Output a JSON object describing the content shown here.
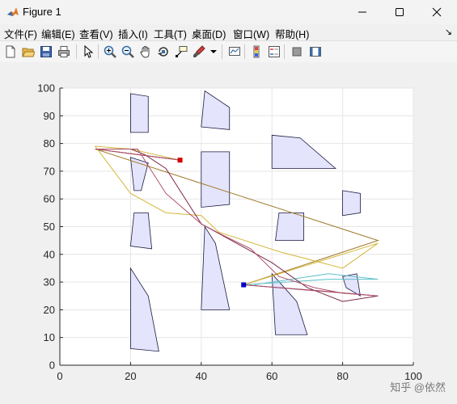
{
  "window": {
    "title": "Figure 1"
  },
  "menu": [
    "文件(F)",
    "编辑(E)",
    "查看(V)",
    "插入(I)",
    "工具(T)",
    "桌面(D)",
    "窗口(W)",
    "帮助(H)"
  ],
  "menu_dock_glyph": "↘",
  "toolbar": [
    "new-figure-icon",
    "open-file-icon",
    "save-icon",
    "print-icon",
    "select-arrow-icon",
    "zoom-in-icon",
    "zoom-out-icon",
    "pan-hand-icon",
    "rotate-3d-icon",
    "data-cursor-icon",
    "brush-icon",
    "brush-dropdown-icon",
    "link-plot-icon",
    "insert-colorbar-icon",
    "insert-legend-icon",
    "hide-plot-tools-icon",
    "show-plot-tools-icon"
  ],
  "watermark": "知乎 @依然",
  "chart_data": {
    "type": "line",
    "xlim": [
      0,
      100
    ],
    "ylim": [
      0,
      100
    ],
    "xticks": [
      0,
      20,
      40,
      60,
      80,
      100
    ],
    "yticks": [
      0,
      10,
      20,
      30,
      40,
      50,
      60,
      70,
      80,
      90,
      100
    ],
    "grid": true,
    "obstacles": [
      [
        [
          20,
          98
        ],
        [
          25,
          97
        ],
        [
          25,
          84
        ],
        [
          20,
          84
        ]
      ],
      [
        [
          41,
          99
        ],
        [
          48,
          93
        ],
        [
          48,
          85
        ],
        [
          40,
          86
        ]
      ],
      [
        [
          60,
          83
        ],
        [
          68,
          82
        ],
        [
          78,
          71
        ],
        [
          60,
          71
        ]
      ],
      [
        [
          20,
          75
        ],
        [
          25,
          73
        ],
        [
          23,
          63
        ],
        [
          21,
          63
        ]
      ],
      [
        [
          40,
          77
        ],
        [
          48,
          77
        ],
        [
          48,
          58
        ],
        [
          40,
          57
        ]
      ],
      [
        [
          80,
          63
        ],
        [
          85,
          62
        ],
        [
          85,
          55
        ],
        [
          80,
          54
        ]
      ],
      [
        [
          21,
          55
        ],
        [
          25,
          55
        ],
        [
          26,
          42
        ],
        [
          20,
          43
        ]
      ],
      [
        [
          62,
          55
        ],
        [
          69,
          55
        ],
        [
          69,
          45
        ],
        [
          61,
          45
        ]
      ],
      [
        [
          41,
          50
        ],
        [
          44,
          44
        ],
        [
          48,
          20
        ],
        [
          40,
          20
        ]
      ],
      [
        [
          60,
          33
        ],
        [
          67,
          23
        ],
        [
          70,
          11
        ],
        [
          61,
          11
        ]
      ],
      [
        [
          80,
          32
        ],
        [
          84,
          33
        ],
        [
          85,
          25
        ],
        [
          81,
          28
        ]
      ],
      [
        [
          20,
          35
        ],
        [
          25,
          25
        ],
        [
          28,
          5
        ],
        [
          20,
          6
        ]
      ]
    ],
    "start": [
      52,
      29
    ],
    "goal": [
      34,
      74
    ],
    "series": [
      {
        "color": "#a07a2a",
        "points": [
          [
            52,
            29
          ],
          [
            90,
            45
          ],
          [
            10,
            78
          ],
          [
            34,
            74
          ]
        ]
      },
      {
        "color": "#d4b83a",
        "points": [
          [
            52,
            29
          ],
          [
            90,
            44
          ],
          [
            80,
            35
          ],
          [
            62,
            41
          ],
          [
            45,
            48
          ],
          [
            40,
            54
          ],
          [
            30,
            55
          ],
          [
            20,
            62
          ],
          [
            10,
            79
          ],
          [
            20,
            78
          ],
          [
            34,
            74
          ]
        ]
      },
      {
        "color": "#5ec0c8",
        "points": [
          [
            52,
            29
          ],
          [
            76,
            31
          ],
          [
            90,
            31
          ],
          [
            76,
            33
          ],
          [
            55,
            29
          ]
        ]
      },
      {
        "color": "#7a2a4a",
        "points": [
          [
            52,
            29
          ],
          [
            62,
            28
          ],
          [
            72,
            27
          ],
          [
            90,
            25
          ],
          [
            80,
            23
          ],
          [
            70,
            28
          ],
          [
            60,
            37
          ],
          [
            50,
            44
          ],
          [
            40,
            51
          ],
          [
            30,
            71
          ],
          [
            24,
            76
          ],
          [
            20,
            78
          ],
          [
            10,
            78
          ],
          [
            34,
            74
          ]
        ]
      },
      {
        "color": "#b0506a",
        "points": [
          [
            52,
            29
          ],
          [
            90,
            25
          ],
          [
            80,
            26
          ],
          [
            72,
            28
          ],
          [
            62,
            32
          ],
          [
            54,
            42
          ],
          [
            46,
            47
          ],
          [
            40,
            51
          ],
          [
            30,
            62
          ],
          [
            22,
            78
          ],
          [
            10,
            78
          ],
          [
            34,
            74
          ]
        ]
      }
    ]
  }
}
